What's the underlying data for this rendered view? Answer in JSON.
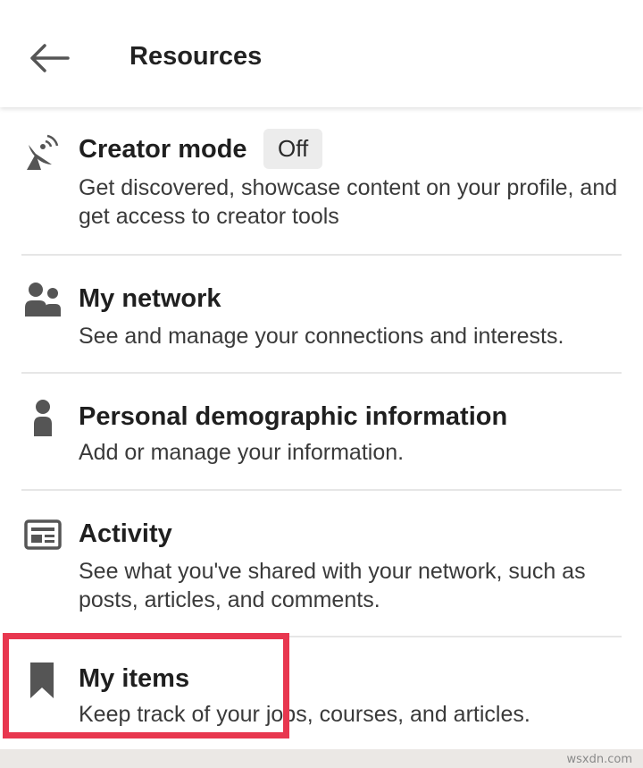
{
  "header": {
    "title": "Resources",
    "back_icon": "arrow-left-icon"
  },
  "items": [
    {
      "icon": "satellite-dish-icon",
      "title": "Creator mode",
      "badge": "Off",
      "description": "Get discovered, showcase content on your profile, and get access to creator tools"
    },
    {
      "icon": "people-icon",
      "title": "My network",
      "description": "See and manage your connections and interests."
    },
    {
      "icon": "person-icon",
      "title": "Personal demographic information",
      "description": "Add or manage your information."
    },
    {
      "icon": "activity-feed-icon",
      "title": "Activity",
      "description": "See what you've shared with your network, such as posts, articles, and comments."
    },
    {
      "icon": "bookmark-icon",
      "title": "My items",
      "description": "Keep track of your jobs, courses, and articles."
    }
  ],
  "highlight_color": "#e8374f",
  "watermark": "wsxdn.com"
}
